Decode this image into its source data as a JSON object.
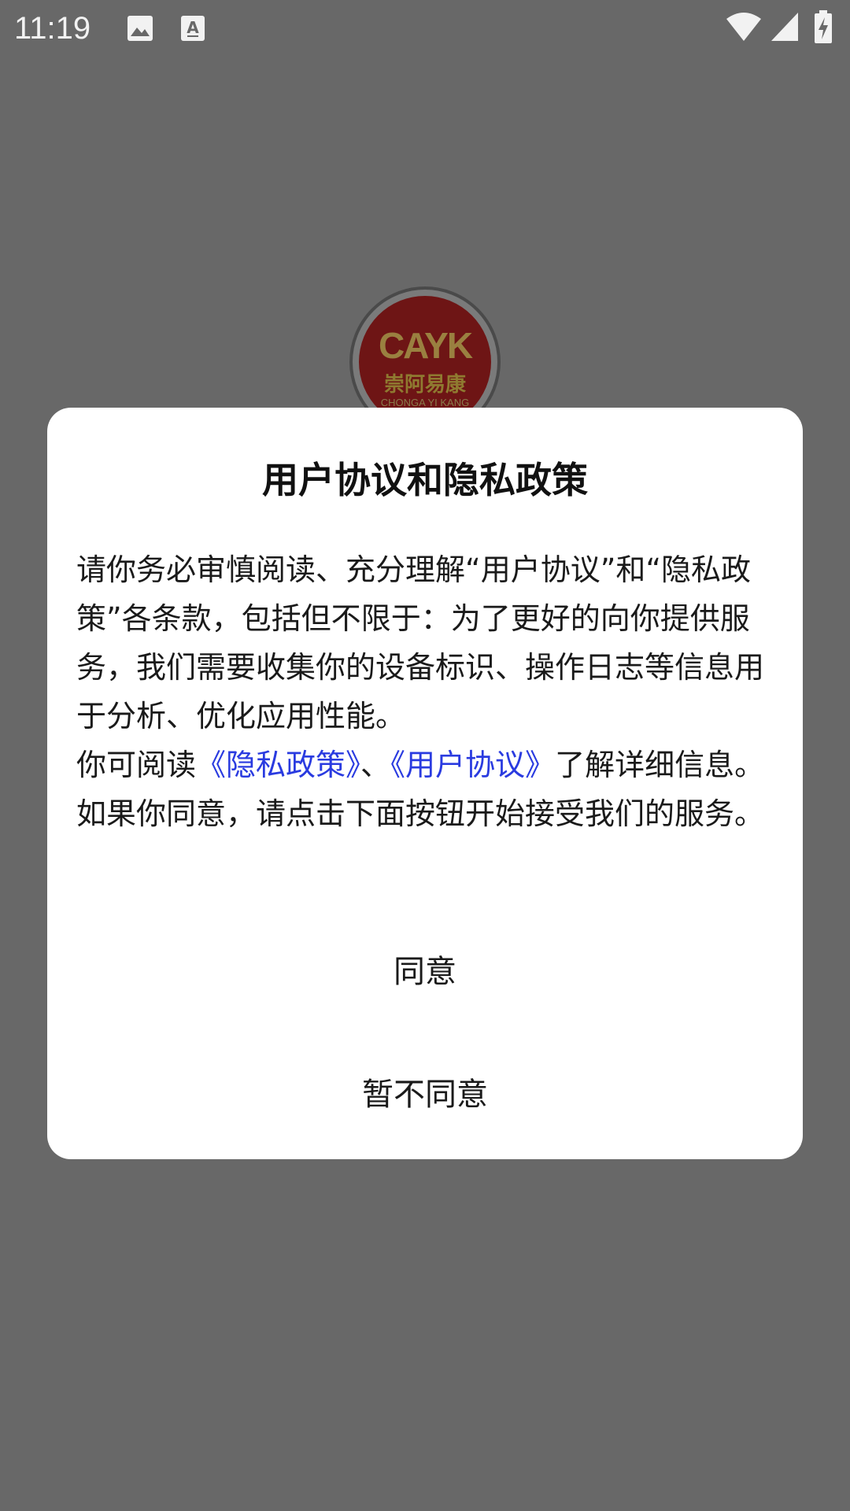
{
  "status_bar": {
    "time": "11:19",
    "icons": [
      "image-icon",
      "text-a-icon",
      "wifi-icon",
      "signal-icon",
      "battery-charging-icon"
    ]
  },
  "logo": {
    "brand": "CAYK",
    "name_cn": "崇阿易康",
    "name_en": "CHONGA YI KANG"
  },
  "dialog": {
    "title": "用户协议和隐私政策",
    "paragraph1": "请你务必审慎阅读、充分理解“用户协议”和“隐私政策”各条款，包括但不限于：为了更好的向你提供服务，我们需要收集你的设备标识、操作日志等信息用于分析、优化应用性能。",
    "p2_prefix": "你可阅读",
    "privacy_link": "《隐私政策》",
    "separator": "、",
    "agreement_link": "《用户协议》",
    "p2_suffix": "了解详细信息。如果你同意，请点击下面按钮开始接受我们的服务。",
    "agree_label": "同意",
    "disagree_label": "暂不同意"
  },
  "colors": {
    "overlay": "#686868",
    "link": "#2a3be0",
    "dialog_bg": "#ffffff"
  }
}
